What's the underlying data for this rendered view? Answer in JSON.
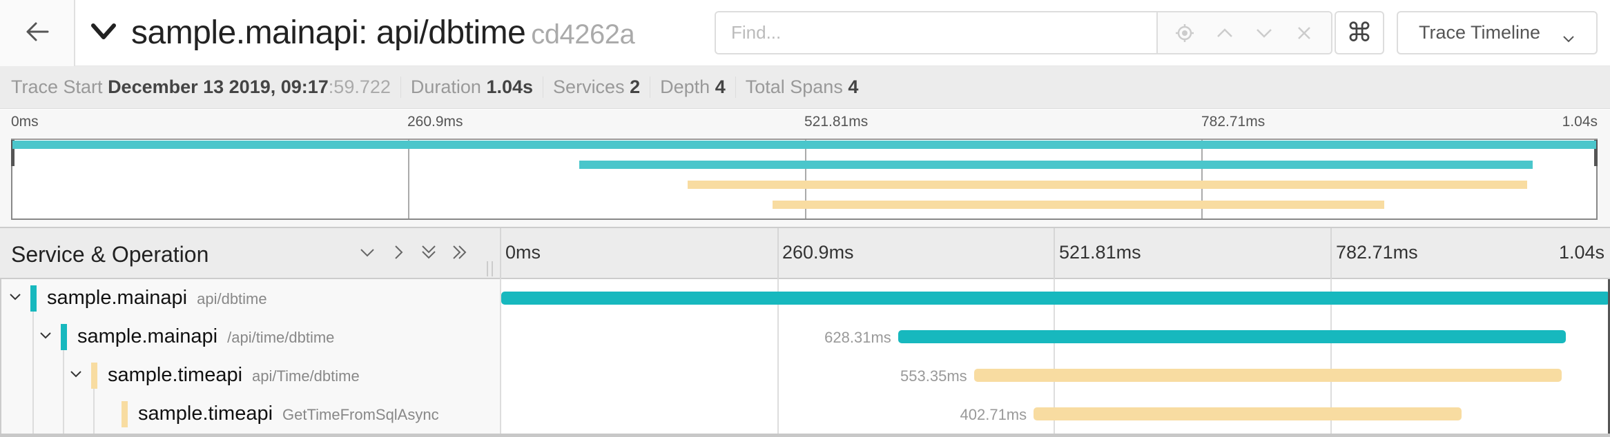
{
  "header": {
    "title": "sample.mainapi: api/dbtime",
    "trace_id": "cd4262a",
    "back_icon": "arrow-left-icon",
    "collapse_icon": "chevron-down-icon",
    "find": {
      "placeholder": "Find...",
      "value": "",
      "icons": [
        "locate-icon",
        "chevron-up-icon",
        "chevron-down-icon",
        "close-icon"
      ]
    },
    "keyboard_shortcuts_icon": "⌘",
    "view_select": {
      "value": "Trace Timeline",
      "icon": "chevron-down-icon"
    }
  },
  "summary": {
    "trace_start_label": "Trace Start",
    "trace_start_value": "December 13 2019, 09:17",
    "trace_start_ms": ":59.722",
    "duration_label": "Duration",
    "duration_value": "1.04s",
    "services_label": "Services",
    "services_value": "2",
    "depth_label": "Depth",
    "depth_value": "4",
    "total_spans_label": "Total Spans",
    "total_spans_value": "4"
  },
  "timeline": {
    "total_ms": 1043.62,
    "ticks": [
      "0ms",
      "260.9ms",
      "521.81ms",
      "782.71ms",
      "1.04s"
    ],
    "column_title": "Service & Operation",
    "header_buttons": [
      {
        "name": "collapse-one-button",
        "icon": "chevron-down-icon"
      },
      {
        "name": "expand-one-button",
        "icon": "chevron-right-icon"
      },
      {
        "name": "collapse-all-button",
        "icon": "double-chevron-down-icon"
      },
      {
        "name": "expand-all-button",
        "icon": "double-chevron-right-icon"
      }
    ]
  },
  "colors": {
    "mainapi": "#17b8be",
    "timeapi": "#f8dca1",
    "mainapi_minimap": "#4ac6cb"
  },
  "spans": [
    {
      "service": "sample.mainapi",
      "operation": "api/dbtime",
      "depth": 0,
      "start_ms": 0,
      "duration_ms": 1043.62,
      "duration_label": "",
      "color_key": "mainapi",
      "expanded": true,
      "has_children": true
    },
    {
      "service": "sample.mainapi",
      "operation": "/api/time/dbtime",
      "depth": 1,
      "start_ms": 373.5,
      "duration_ms": 628.31,
      "duration_label": "628.31ms",
      "color_key": "mainapi",
      "expanded": true,
      "has_children": true
    },
    {
      "service": "sample.timeapi",
      "operation": "api/Time/dbtime",
      "depth": 2,
      "start_ms": 444.9,
      "duration_ms": 553.35,
      "duration_label": "553.35ms",
      "color_key": "timeapi",
      "expanded": true,
      "has_children": true
    },
    {
      "service": "sample.timeapi",
      "operation": "GetTimeFromSqlAsync",
      "depth": 3,
      "start_ms": 501.1,
      "duration_ms": 402.71,
      "duration_label": "402.71ms",
      "color_key": "timeapi",
      "expanded": false,
      "has_children": false
    }
  ]
}
